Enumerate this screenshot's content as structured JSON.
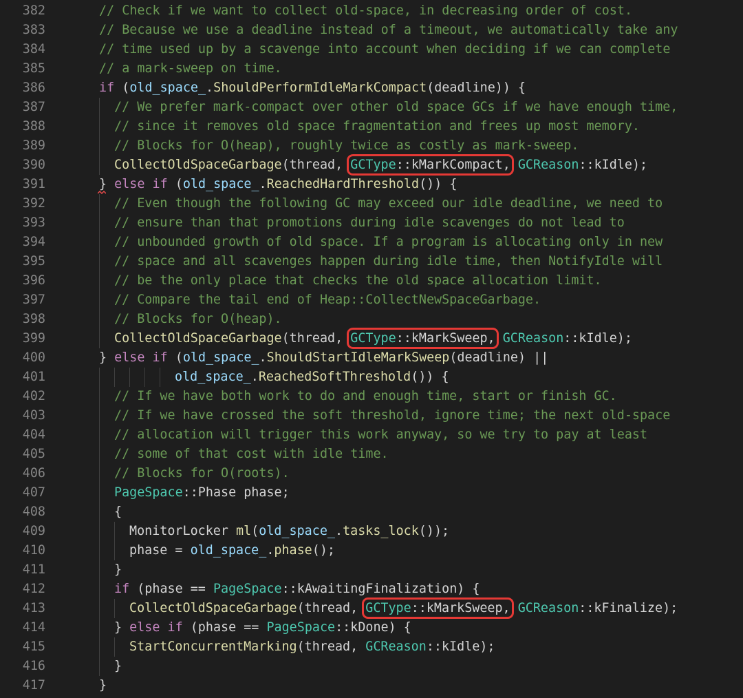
{
  "lines": [
    {
      "n": "382",
      "indent": 0,
      "tokens": [
        {
          "t": "// Check if we want to collect old-space, in decreasing order of cost.",
          "c": "comment"
        }
      ]
    },
    {
      "n": "383",
      "indent": 0,
      "tokens": [
        {
          "t": "// Because we use a deadline instead of a timeout, we automatically take any",
          "c": "comment"
        }
      ]
    },
    {
      "n": "384",
      "indent": 0,
      "tokens": [
        {
          "t": "// time used up by a scavenge into account when deciding if we can complete",
          "c": "comment"
        }
      ]
    },
    {
      "n": "385",
      "indent": 0,
      "tokens": [
        {
          "t": "// a mark-sweep on time.",
          "c": "comment"
        }
      ]
    },
    {
      "n": "386",
      "indent": 0,
      "tokens": [
        {
          "t": "if",
          "c": "keyword"
        },
        {
          "t": " (",
          "c": "plain"
        },
        {
          "t": "old_space_",
          "c": "var"
        },
        {
          "t": ".",
          "c": "plain"
        },
        {
          "t": "ShouldPerformIdleMarkCompact",
          "c": "fn"
        },
        {
          "t": "(deadline)) {",
          "c": "plain"
        }
      ]
    },
    {
      "n": "387",
      "indent": 1,
      "tokens": [
        {
          "t": "// We prefer mark-compact over other old space GCs if we have enough time,",
          "c": "comment"
        }
      ]
    },
    {
      "n": "388",
      "indent": 1,
      "tokens": [
        {
          "t": "// since it removes old space fragmentation and frees up most memory.",
          "c": "comment"
        }
      ]
    },
    {
      "n": "389",
      "indent": 1,
      "tokens": [
        {
          "t": "// Blocks for O(heap), roughly twice as costly as mark-sweep.",
          "c": "comment"
        }
      ]
    },
    {
      "n": "390",
      "indent": 1,
      "tokens": [
        {
          "t": "CollectOldSpaceGarbage",
          "c": "fn"
        },
        {
          "t": "(thread, ",
          "c": "plain"
        },
        {
          "t": "GCType",
          "c": "type",
          "hl": "start"
        },
        {
          "t": "::kMarkCompact,",
          "c": "plain",
          "hl": "end"
        },
        {
          "t": " ",
          "c": "plain"
        },
        {
          "t": "GCReason",
          "c": "type"
        },
        {
          "t": "::kIdle);",
          "c": "plain"
        }
      ]
    },
    {
      "n": "391",
      "indent": 0,
      "tokens": [
        {
          "t": "}",
          "c": "plain"
        },
        {
          "t": " else if",
          "c": "keyword"
        },
        {
          "t": " (",
          "c": "plain"
        },
        {
          "t": "old_space_",
          "c": "var"
        },
        {
          "t": ".",
          "c": "plain"
        },
        {
          "t": "ReachedHardThreshold",
          "c": "fn"
        },
        {
          "t": "()) {",
          "c": "plain"
        }
      ]
    },
    {
      "n": "392",
      "indent": 1,
      "tokens": [
        {
          "t": "// Even though the following GC may exceed our idle deadline, we need to",
          "c": "comment"
        }
      ]
    },
    {
      "n": "393",
      "indent": 1,
      "tokens": [
        {
          "t": "// ensure than that promotions during idle scavenges do not lead to",
          "c": "comment"
        }
      ]
    },
    {
      "n": "394",
      "indent": 1,
      "tokens": [
        {
          "t": "// unbounded growth of old space. If a program is allocating only in new",
          "c": "comment"
        }
      ]
    },
    {
      "n": "395",
      "indent": 1,
      "tokens": [
        {
          "t": "// space and all scavenges happen during idle time, then NotifyIdle will",
          "c": "comment"
        }
      ]
    },
    {
      "n": "396",
      "indent": 1,
      "tokens": [
        {
          "t": "// be the only place that checks the old space allocation limit.",
          "c": "comment"
        }
      ]
    },
    {
      "n": "397",
      "indent": 1,
      "tokens": [
        {
          "t": "// Compare the tail end of Heap::CollectNewSpaceGarbage.",
          "c": "comment"
        }
      ]
    },
    {
      "n": "398",
      "indent": 1,
      "tokens": [
        {
          "t": "// Blocks for O(heap).",
          "c": "comment"
        }
      ]
    },
    {
      "n": "399",
      "indent": 1,
      "tokens": [
        {
          "t": "CollectOldSpaceGarbage",
          "c": "fn"
        },
        {
          "t": "(thread, ",
          "c": "plain"
        },
        {
          "t": "GCType",
          "c": "type",
          "hl": "start"
        },
        {
          "t": "::kMarkSweep,",
          "c": "plain",
          "hl": "end"
        },
        {
          "t": " ",
          "c": "plain"
        },
        {
          "t": "GCReason",
          "c": "type"
        },
        {
          "t": "::kIdle);",
          "c": "plain"
        }
      ]
    },
    {
      "n": "400",
      "indent": 0,
      "tokens": [
        {
          "t": "}",
          "c": "plain"
        },
        {
          "t": " else if",
          "c": "keyword"
        },
        {
          "t": " (",
          "c": "plain"
        },
        {
          "t": "old_space_",
          "c": "var"
        },
        {
          "t": ".",
          "c": "plain"
        },
        {
          "t": "ShouldStartIdleMarkSweep",
          "c": "fn"
        },
        {
          "t": "(deadline) ||",
          "c": "plain"
        }
      ]
    },
    {
      "n": "401",
      "indent": 5,
      "tokens": [
        {
          "t": "old_space_",
          "c": "var"
        },
        {
          "t": ".",
          "c": "plain"
        },
        {
          "t": "ReachedSoftThreshold",
          "c": "fn"
        },
        {
          "t": "()) {",
          "c": "plain"
        }
      ]
    },
    {
      "n": "402",
      "indent": 1,
      "tokens": [
        {
          "t": "// If we have both work to do and enough time, start or finish GC.",
          "c": "comment"
        }
      ]
    },
    {
      "n": "403",
      "indent": 1,
      "tokens": [
        {
          "t": "// If we have crossed the soft threshold, ignore time; the next old-space",
          "c": "comment"
        }
      ]
    },
    {
      "n": "404",
      "indent": 1,
      "tokens": [
        {
          "t": "// allocation will trigger this work anyway, so we try to pay at least",
          "c": "comment"
        }
      ]
    },
    {
      "n": "405",
      "indent": 1,
      "tokens": [
        {
          "t": "// some of that cost with idle time.",
          "c": "comment"
        }
      ]
    },
    {
      "n": "406",
      "indent": 1,
      "tokens": [
        {
          "t": "// Blocks for O(roots).",
          "c": "comment"
        }
      ]
    },
    {
      "n": "407",
      "indent": 1,
      "tokens": [
        {
          "t": "PageSpace",
          "c": "type"
        },
        {
          "t": "::Phase phase;",
          "c": "plain"
        }
      ]
    },
    {
      "n": "408",
      "indent": 1,
      "tokens": [
        {
          "t": "{",
          "c": "plain"
        }
      ]
    },
    {
      "n": "409",
      "indent": 2,
      "tokens": [
        {
          "t": "MonitorLocker ",
          "c": "plain"
        },
        {
          "t": "ml",
          "c": "fn"
        },
        {
          "t": "(",
          "c": "plain"
        },
        {
          "t": "old_space_",
          "c": "var"
        },
        {
          "t": ".",
          "c": "plain"
        },
        {
          "t": "tasks_lock",
          "c": "fn"
        },
        {
          "t": "());",
          "c": "plain"
        }
      ]
    },
    {
      "n": "410",
      "indent": 2,
      "tokens": [
        {
          "t": "phase = ",
          "c": "plain"
        },
        {
          "t": "old_space_",
          "c": "var"
        },
        {
          "t": ".",
          "c": "plain"
        },
        {
          "t": "phase",
          "c": "fn"
        },
        {
          "t": "();",
          "c": "plain"
        }
      ]
    },
    {
      "n": "411",
      "indent": 1,
      "tokens": [
        {
          "t": "}",
          "c": "plain"
        }
      ]
    },
    {
      "n": "412",
      "indent": 1,
      "tokens": [
        {
          "t": "if",
          "c": "keyword"
        },
        {
          "t": " (phase == ",
          "c": "plain"
        },
        {
          "t": "PageSpace",
          "c": "type"
        },
        {
          "t": "::kAwaitingFinalization) {",
          "c": "plain"
        }
      ]
    },
    {
      "n": "413",
      "indent": 2,
      "tokens": [
        {
          "t": "CollectOldSpaceGarbage",
          "c": "fn"
        },
        {
          "t": "(thread, ",
          "c": "plain"
        },
        {
          "t": "GCType",
          "c": "type",
          "hl": "start"
        },
        {
          "t": "::kMarkSweep,",
          "c": "plain",
          "hl": "end"
        },
        {
          "t": " ",
          "c": "plain"
        },
        {
          "t": "GCReason",
          "c": "type"
        },
        {
          "t": "::kFinalize);",
          "c": "plain"
        }
      ]
    },
    {
      "n": "414",
      "indent": 1,
      "tokens": [
        {
          "t": "}",
          "c": "plain"
        },
        {
          "t": " else if",
          "c": "keyword"
        },
        {
          "t": " (phase == ",
          "c": "plain"
        },
        {
          "t": "PageSpace",
          "c": "type"
        },
        {
          "t": "::kDone) {",
          "c": "plain"
        }
      ]
    },
    {
      "n": "415",
      "indent": 2,
      "tokens": [
        {
          "t": "StartConcurrentMarking",
          "c": "fn"
        },
        {
          "t": "(thread, ",
          "c": "plain"
        },
        {
          "t": "GCReason",
          "c": "type"
        },
        {
          "t": "::kIdle);",
          "c": "plain"
        }
      ]
    },
    {
      "n": "416",
      "indent": 1,
      "tokens": [
        {
          "t": "}",
          "c": "plain"
        }
      ]
    },
    {
      "n": "417",
      "indent": 0,
      "tokens": [
        {
          "t": "}",
          "c": "plain"
        }
      ]
    }
  ],
  "colors": {
    "background": "#1e1e1e",
    "line_number": "#858585",
    "comment": "#6a9955",
    "keyword": "#c586c0",
    "variable": "#9cdcfe",
    "function": "#dcdcaa",
    "type": "#4ec9b0",
    "plain": "#d4d4d4",
    "highlight_box": "#e53935",
    "error_squiggle": "#f14c4c"
  }
}
